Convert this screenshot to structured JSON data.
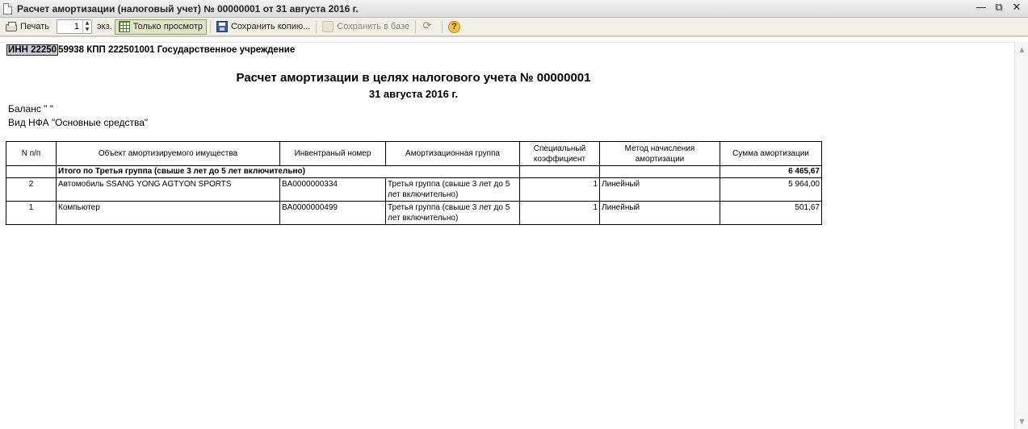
{
  "window": {
    "title": "Расчет амортизации (налоговый учет) № 00000001 от 31 августа 2016 г.",
    "controls": [
      "—",
      "⧉",
      "✕"
    ]
  },
  "toolbar": {
    "print_label": "Печать",
    "copies_value": "1",
    "copies_unit": "экз.",
    "view_only_label": "Только просмотр",
    "save_copy_label": "Сохранить копию...",
    "save_db_label": "Сохранить в базе",
    "help_label": "?"
  },
  "report": {
    "inn_selected": "ИНН 22250",
    "inn_rest": "59938 КПП 222501001 Государственное учреждение",
    "title": "Расчет амортизации в целях налогового учета № 00000001",
    "date": "31 августа 2016 г.",
    "balance": "Баланс \" \"",
    "nfa_type": "Вид НФА \"Основные средства\"",
    "columns": [
      "N п/п",
      "Объект амортизируемого имущества",
      "Инвентраный номер",
      "Амортизационная группа",
      "Специальный коэффициент",
      "Метод начисления амортизации",
      "Сумма амортизации"
    ],
    "group": {
      "label": "Итого по Третья группа (свыше 3 лет до 5 лет включительно)",
      "total": "6 465,67"
    },
    "rows": [
      {
        "num": "2",
        "object": "Автомобиль SSANG YONG AGTYON SPORTS",
        "inventory": "BA0000000334",
        "group": "Третья группа (свыше 3 лет до 5 лет включительно)",
        "coef": "1",
        "method": "Линейный",
        "amount": "5 964,00"
      },
      {
        "num": "1",
        "object": "Компьютер",
        "inventory": "BA0000000499",
        "group": "Третья группа (свыше 3 лет до 5 лет включительно)",
        "coef": "1",
        "method": "Линейный",
        "amount": "501,67"
      }
    ]
  }
}
